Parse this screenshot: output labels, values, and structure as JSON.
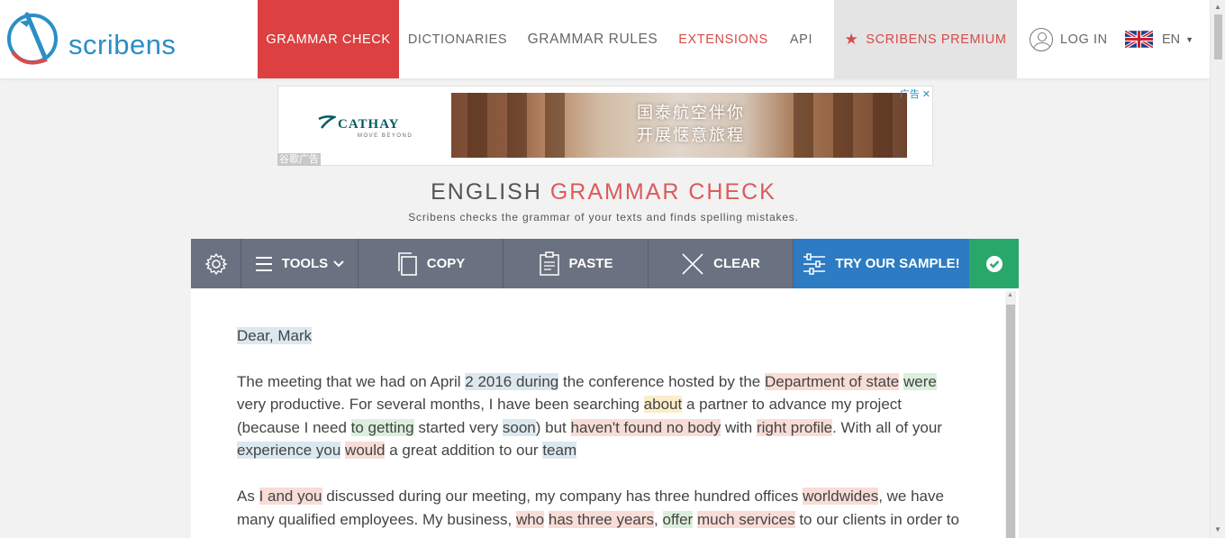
{
  "header": {
    "logo_text": "scribens",
    "nav": [
      {
        "label": "GRAMMAR CHECK"
      },
      {
        "label": "DICTIONARIES"
      },
      {
        "label": "GRAMMAR RULES"
      },
      {
        "label": "EXTENSIONS"
      },
      {
        "label": "API"
      },
      {
        "label": "SCRIBENS PREMIUM"
      }
    ],
    "login_label": "LOG IN",
    "language": "EN"
  },
  "ad": {
    "brand": "CATHAY",
    "tagline": "MOVE BEYOND",
    "line1": "国泰航空伴你",
    "line2": "开展惬意旅程",
    "google_label": "谷歌广告",
    "ad_choice": "广告"
  },
  "title": {
    "part1": "ENGLISH",
    "part2": "GRAMMAR CHECK",
    "subtitle": "Scribens checks the grammar of your texts and finds spelling mistakes."
  },
  "toolbar": {
    "tools_label": "TOOLS",
    "copy_label": "COPY",
    "paste_label": "PASTE",
    "clear_label": "CLEAR",
    "sample_label": "TRY OUR SAMPLE!"
  },
  "editor": {
    "p1": [
      {
        "text": "Dear, Mark",
        "hl": "blue"
      }
    ],
    "p2": [
      {
        "text": "The meeting that we had on April ",
        "hl": ""
      },
      {
        "text": "2 2016 during",
        "hl": "blue"
      },
      {
        "text": " the conference hosted by the ",
        "hl": ""
      },
      {
        "text": "Department of state",
        "hl": "red"
      },
      {
        "text": " ",
        "hl": ""
      },
      {
        "text": "were",
        "hl": "green"
      },
      {
        "text": " very productive. For several months, I have been searching ",
        "hl": ""
      },
      {
        "text": "about",
        "hl": "yellow"
      },
      {
        "text": " a partner to advance my project (because I need ",
        "hl": ""
      },
      {
        "text": "to getting",
        "hl": "green"
      },
      {
        "text": " started very ",
        "hl": ""
      },
      {
        "text": "soon",
        "hl": "blue"
      },
      {
        "text": ") but ",
        "hl": ""
      },
      {
        "text": "haven't found no body",
        "hl": "red"
      },
      {
        "text": " with ",
        "hl": ""
      },
      {
        "text": "right profile",
        "hl": "red"
      },
      {
        "text": ". With all of your ",
        "hl": ""
      },
      {
        "text": "experience you",
        "hl": "blue"
      },
      {
        "text": " ",
        "hl": ""
      },
      {
        "text": "would",
        "hl": "red"
      },
      {
        "text": " a great addition to our ",
        "hl": ""
      },
      {
        "text": "team",
        "hl": "blue"
      }
    ],
    "p3": [
      {
        "text": "As ",
        "hl": ""
      },
      {
        "text": "I and you",
        "hl": "red"
      },
      {
        "text": " discussed during our meeting, my company has three hundred offices ",
        "hl": ""
      },
      {
        "text": "worldwides",
        "hl": "red"
      },
      {
        "text": ", we have many qualified employees. My business, ",
        "hl": ""
      },
      {
        "text": "who",
        "hl": "red"
      },
      {
        "text": " ",
        "hl": ""
      },
      {
        "text": "has three years",
        "hl": "red"
      },
      {
        "text": ", ",
        "hl": ""
      },
      {
        "text": "offer",
        "hl": "green"
      },
      {
        "text": " ",
        "hl": ""
      },
      {
        "text": "much services",
        "hl": "red"
      },
      {
        "text": " to our clients in order to",
        "hl": ""
      }
    ]
  }
}
